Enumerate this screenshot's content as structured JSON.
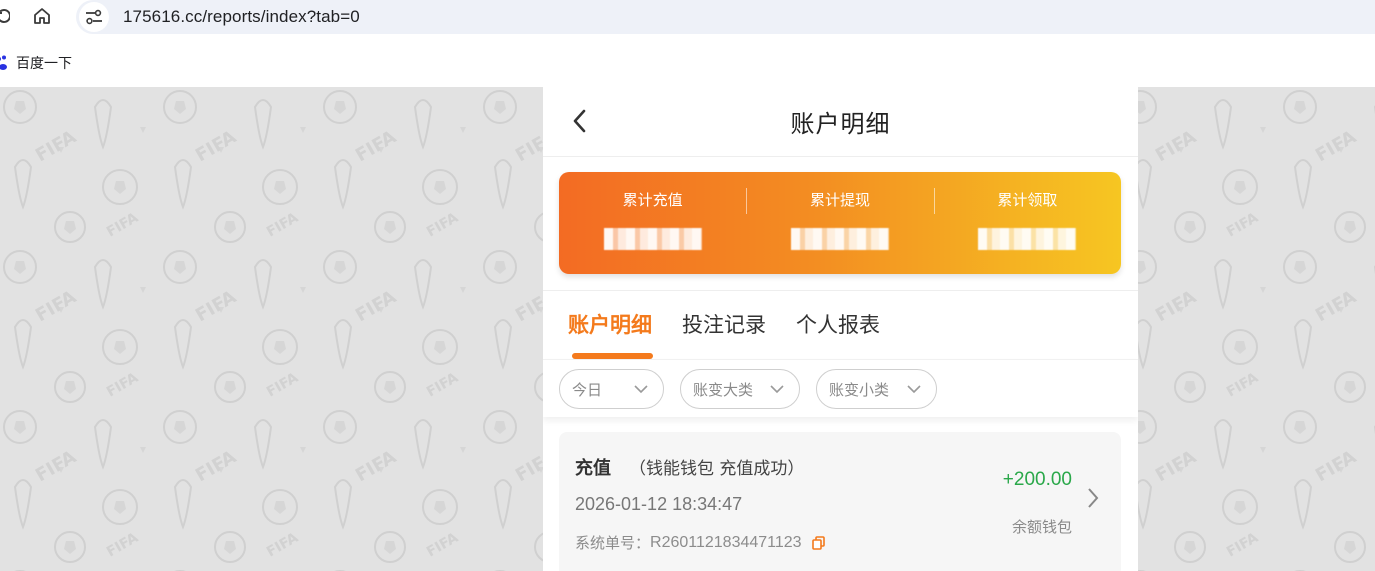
{
  "browser": {
    "url": "175616.cc/reports/index?tab=0",
    "bookmark_label": "百度一下"
  },
  "header": {
    "title": "账户明细"
  },
  "summary": [
    {
      "label": "累计充值",
      "value": ""
    },
    {
      "label": "累计提现",
      "value": ""
    },
    {
      "label": "累计领取",
      "value": ""
    }
  ],
  "tabs": [
    {
      "label": "账户明细",
      "active": true
    },
    {
      "label": "投注记录",
      "active": false
    },
    {
      "label": "个人报表",
      "active": false
    }
  ],
  "filters": [
    {
      "label": "今日"
    },
    {
      "label": "账变大类"
    },
    {
      "label": "账变小类"
    }
  ],
  "record": {
    "type": "充值",
    "desc": "（钱能钱包 充值成功）",
    "time": "2026-01-12 18:34:47",
    "order_label": "系统单号：",
    "order_value": "R2601121834471123",
    "amount": "+200.00",
    "wallet": "余额钱包"
  },
  "colors": {
    "accent": "#f47a1c",
    "amount_positive": "#2aa84a",
    "gradient_start": "#f36b23",
    "gradient_end": "#f6c622"
  }
}
